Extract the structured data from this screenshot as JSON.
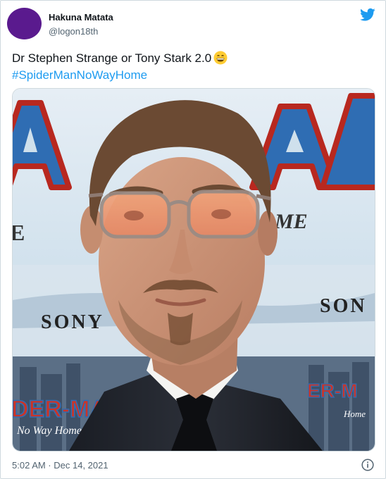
{
  "user": {
    "display_name": "Hakuna Matata",
    "handle": "@logon18th"
  },
  "tweet": {
    "text": "Dr Stephen Strange or Tony Stark 2.0",
    "emoji": "grinning-face-emoji",
    "hashtag": "#SpiderManNoWayHome",
    "timestamp": "5:02 AM · Dec 14, 2021"
  },
  "media": {
    "backdrop_text": {
      "sony_left": "SONY",
      "sony_right": "SON",
      "home_partial": "ME",
      "e_partial": "E",
      "logo_top": "MA A MA",
      "logo_bottom": "DER-MA",
      "logo_bottom_right": "ER-M",
      "tagline": "No Way Home",
      "tagline_right": "Home"
    }
  },
  "icons": {
    "brand": "twitter-bird-icon",
    "info": "info-icon"
  },
  "colors": {
    "avatar": "#5a1a8e",
    "link": "#1d9bf0",
    "brand": "#1d9bf0",
    "muted": "#536471"
  }
}
